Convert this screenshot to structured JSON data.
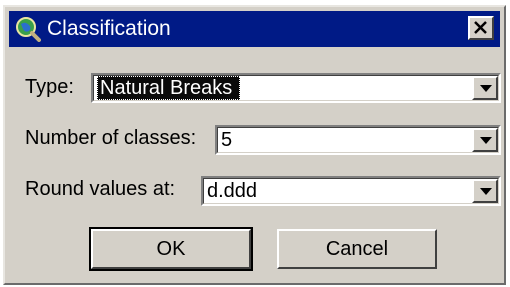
{
  "window": {
    "title": "Classification",
    "title_icon": "globe-magnifier-icon",
    "close_icon": "close-icon",
    "titlebar_color": "#001a86"
  },
  "form": {
    "type": {
      "label": "Type:",
      "value": "Natural Breaks"
    },
    "classes": {
      "label": "Number of classes:",
      "value": "5"
    },
    "round": {
      "label": "Round values at:",
      "value": "d.ddd"
    }
  },
  "buttons": {
    "ok": "OK",
    "cancel": "Cancel"
  }
}
